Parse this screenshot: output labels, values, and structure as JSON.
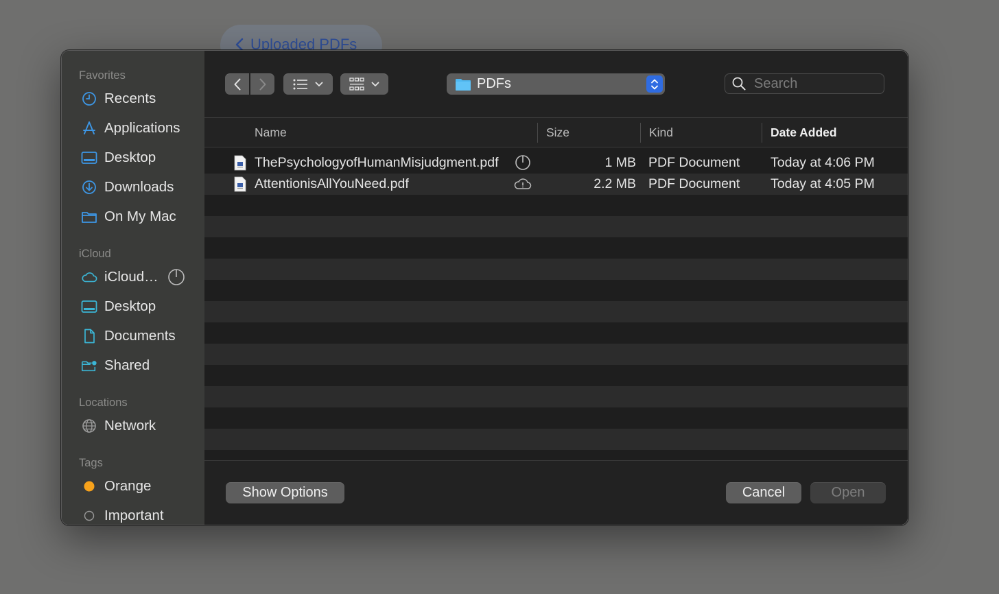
{
  "background": {
    "back_label": "Uploaded PDFs"
  },
  "sidebar": {
    "sections": [
      {
        "title": "Favorites",
        "items": [
          {
            "label": "Recents",
            "icon": "clock-icon"
          },
          {
            "label": "Applications",
            "icon": "applications-icon"
          },
          {
            "label": "Desktop",
            "icon": "desktop-icon"
          },
          {
            "label": "Downloads",
            "icon": "downloads-icon"
          },
          {
            "label": "On My Mac",
            "icon": "folder-icon"
          }
        ]
      },
      {
        "title": "iCloud",
        "items": [
          {
            "label": "iCloud…",
            "icon": "icloud-icon"
          },
          {
            "label": "Desktop",
            "icon": "desktop-icon"
          },
          {
            "label": "Documents",
            "icon": "document-icon"
          },
          {
            "label": "Shared",
            "icon": "shared-folder-icon"
          }
        ]
      },
      {
        "title": "Locations",
        "items": [
          {
            "label": "Network",
            "icon": "globe-icon"
          }
        ]
      },
      {
        "title": "Tags",
        "items": [
          {
            "label": "Orange",
            "icon": "orange-tag-icon",
            "color": "#f7a21b"
          },
          {
            "label": "Important",
            "icon": "tag-icon"
          }
        ]
      }
    ]
  },
  "toolbar": {
    "location": "PDFs",
    "search_placeholder": "Search"
  },
  "columns": {
    "name": "Name",
    "size": "Size",
    "kind": "Kind",
    "date": "Date Added"
  },
  "files": [
    {
      "name": "ThePsychologyofHumanMisjudgment.pdf",
      "status_icon": "download-progress-icon",
      "size": "1 MB",
      "kind": "PDF Document",
      "date": "Today at 4:06 PM"
    },
    {
      "name": "AttentionisAllYouNeed.pdf",
      "status_icon": "cloud-alert-icon",
      "size": "2.2 MB",
      "kind": "PDF Document",
      "date": "Today at 4:05 PM"
    }
  ],
  "footer": {
    "show_options": "Show Options",
    "cancel": "Cancel",
    "open": "Open"
  },
  "colors": {
    "accent": "#2f6ce2",
    "sidebar_icon": "#3d97e6",
    "icloud_icon": "#3bb6d6"
  }
}
